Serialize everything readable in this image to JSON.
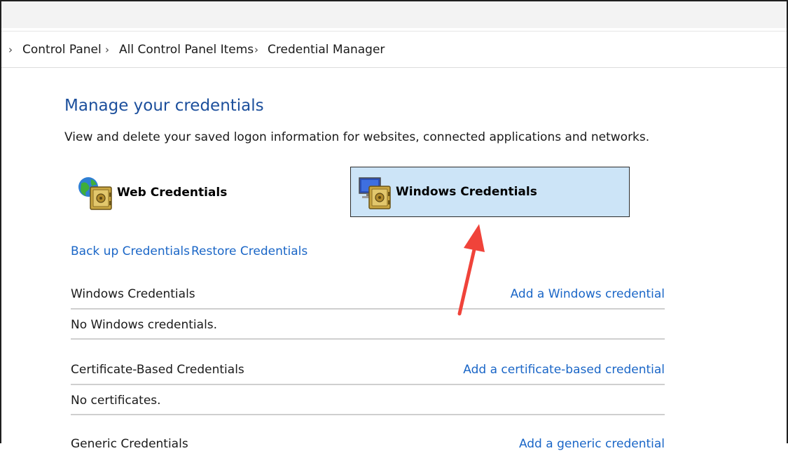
{
  "breadcrumb": {
    "items": [
      "Control Panel",
      "All Control Panel Items",
      "Credential Manager"
    ]
  },
  "main": {
    "title": "Manage your credentials",
    "subtitle": "View and delete your saved logon information for websites, connected applications and networks.",
    "tiles": {
      "web": {
        "label": "Web Credentials",
        "icon": "web-credentials-vault-icon"
      },
      "windows": {
        "label": "Windows Credentials",
        "icon": "windows-credentials-vault-icon",
        "selected": true
      }
    },
    "actions": {
      "backup": "Back up Credentials",
      "restore": "Restore Credentials"
    },
    "sections": [
      {
        "title": "Windows Credentials",
        "add_link": "Add a Windows credential",
        "empty_text": "No Windows credentials."
      },
      {
        "title": "Certificate-Based Credentials",
        "add_link": "Add a certificate-based credential",
        "empty_text": "No certificates."
      },
      {
        "title": "Generic Credentials",
        "add_link": "Add a generic credential"
      }
    ]
  },
  "colors": {
    "title_blue": "#1c4f9c",
    "link_blue": "#1a66c7",
    "selected_tile": "#cce4f7",
    "annotation_arrow": "#f0433a"
  }
}
